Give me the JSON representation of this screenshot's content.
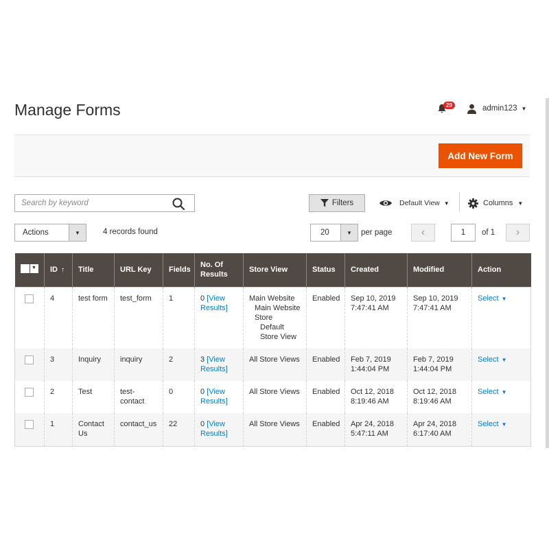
{
  "header": {
    "title": "Manage Forms",
    "notifications_count": "29",
    "username": "admin123"
  },
  "actions_bar": {
    "add_button": "Add New Form"
  },
  "toolbar": {
    "search_placeholder": "Search by keyword",
    "filters_label": "Filters",
    "view_label": "Default View",
    "columns_label": "Columns",
    "mass_actions_label": "Actions",
    "records_found": "4 records found",
    "per_page_value": "20",
    "per_page_label": "per page",
    "current_page": "1",
    "total_pages_label": "of 1"
  },
  "icons": {
    "notification": "bell-icon",
    "user": "user-icon",
    "search": "search-icon",
    "filter": "funnel-icon",
    "view": "eye-icon",
    "columns": "gear-icon",
    "prev": "chevron-left-icon",
    "next": "chevron-right-icon"
  },
  "colors": {
    "accent": "#eb5202",
    "header_bg": "#514943",
    "link": "#007bdb",
    "badge": "#e22626"
  },
  "table": {
    "columns": [
      "ID",
      "Title",
      "URL Key",
      "Fields",
      "No. Of Results",
      "Store View",
      "Status",
      "Created",
      "Modified",
      "Action"
    ],
    "rows": [
      {
        "id": "4",
        "title": "test form",
        "url_key": "test_form",
        "fields": "1",
        "results_count": "0",
        "results_link": "[View Results]",
        "store_view": [
          "Main Website",
          "Main Website Store",
          "Default Store View"
        ],
        "status": "Enabled",
        "created": "Sep 10, 2019 7:47:41 AM",
        "modified": "Sep 10, 2019 7:47:41 AM",
        "action": "Select"
      },
      {
        "id": "3",
        "title": "Inquiry",
        "url_key": "inquiry",
        "fields": "2",
        "results_count": "3",
        "results_link": "[View Results]",
        "store_view": [
          "All Store Views"
        ],
        "status": "Enabled",
        "created": "Feb 7, 2019 1:44:04 PM",
        "modified": "Feb 7, 2019 1:44:04 PM",
        "action": "Select"
      },
      {
        "id": "2",
        "title": "Test",
        "url_key": "test-contact",
        "fields": "0",
        "results_count": "0",
        "results_link": "[View Results]",
        "store_view": [
          "All Store Views"
        ],
        "status": "Enabled",
        "created": "Oct 12, 2018 8:19:46 AM",
        "modified": "Oct 12, 2018 8:19:46 AM",
        "action": "Select"
      },
      {
        "id": "1",
        "title": "Contact Us",
        "url_key": "contact_us",
        "fields": "22",
        "results_count": "0",
        "results_link": "[View Results]",
        "store_view": [
          "All Store Views"
        ],
        "status": "Enabled",
        "created": "Apr 24, 2018 5:47:11 AM",
        "modified": "Apr 24, 2018 6:17:40 AM",
        "action": "Select"
      }
    ]
  }
}
